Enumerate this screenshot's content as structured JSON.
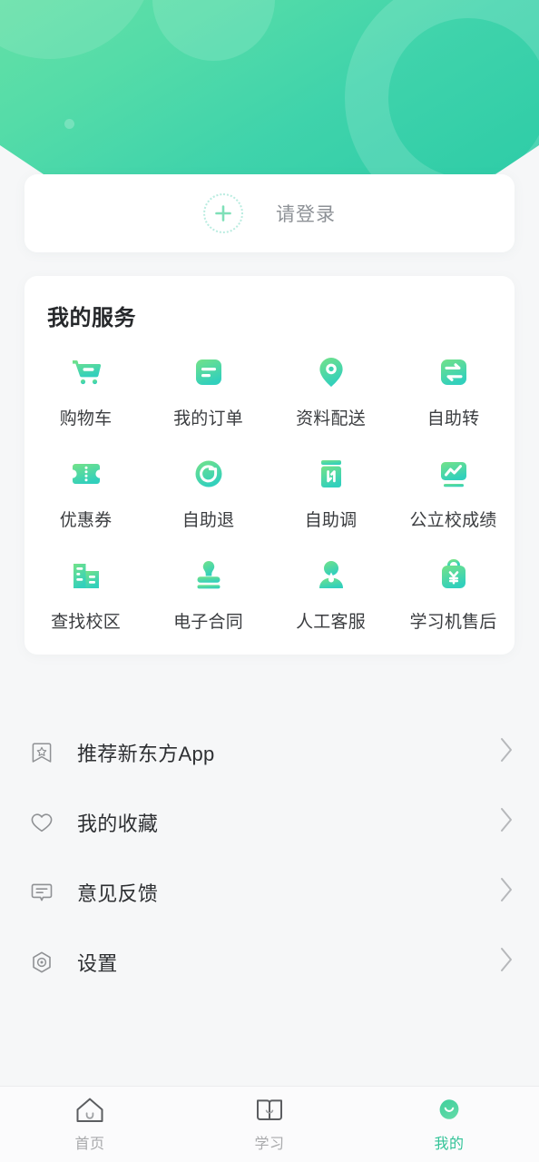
{
  "theme": {
    "brand_green": "#33C398",
    "gradient_from": "#63E0A6",
    "gradient_to": "#2ECCA7",
    "icon_gradient_from": "#6FE08A",
    "icon_gradient_to": "#32CFC0",
    "text_primary": "#2d2f32",
    "text_muted": "#8d9196",
    "page_bg": "#f6f7f8"
  },
  "header": {
    "decorations": [
      "circle-blob-upper-left",
      "circle-blob-top-middle",
      "donut-ring-right",
      "small-dot"
    ]
  },
  "login": {
    "avatar_icon": "plus-icon",
    "label": "请登录"
  },
  "services": {
    "title": "我的服务",
    "items": [
      {
        "label": "购物车",
        "icon": "shopping-cart-icon"
      },
      {
        "label": "我的订单",
        "icon": "order-list-icon"
      },
      {
        "label": "资料配送",
        "icon": "location-pin-icon"
      },
      {
        "label": "自助转",
        "icon": "transfer-arrows-icon"
      },
      {
        "label": "优惠券",
        "icon": "coupon-ticket-icon"
      },
      {
        "label": "自助退",
        "icon": "refund-circle-icon"
      },
      {
        "label": "自助调",
        "icon": "book-adjust-icon"
      },
      {
        "label": "公立校成绩",
        "icon": "score-chart-icon"
      },
      {
        "label": "查找校区",
        "icon": "building-icon"
      },
      {
        "label": "电子合同",
        "icon": "stamp-seal-icon"
      },
      {
        "label": "人工客服",
        "icon": "customer-service-icon"
      },
      {
        "label": "学习机售后",
        "icon": "yuan-bag-icon"
      }
    ]
  },
  "menu": {
    "items": [
      {
        "label": "推荐新东方App",
        "icon": "bookmark-star-icon",
        "chevron": "chevron-right-icon"
      },
      {
        "label": "我的收藏",
        "icon": "heart-icon",
        "chevron": "chevron-right-icon"
      },
      {
        "label": "意见反馈",
        "icon": "feedback-chat-icon",
        "chevron": "chevron-right-icon"
      },
      {
        "label": "设置",
        "icon": "settings-hex-icon",
        "chevron": "chevron-right-icon"
      }
    ]
  },
  "tabbar": {
    "tabs": [
      {
        "label": "首页",
        "icon": "home-icon",
        "active": false
      },
      {
        "label": "学习",
        "icon": "book-icon",
        "active": false
      },
      {
        "label": "我的",
        "icon": "profile-leaf-icon",
        "active": true
      }
    ]
  }
}
